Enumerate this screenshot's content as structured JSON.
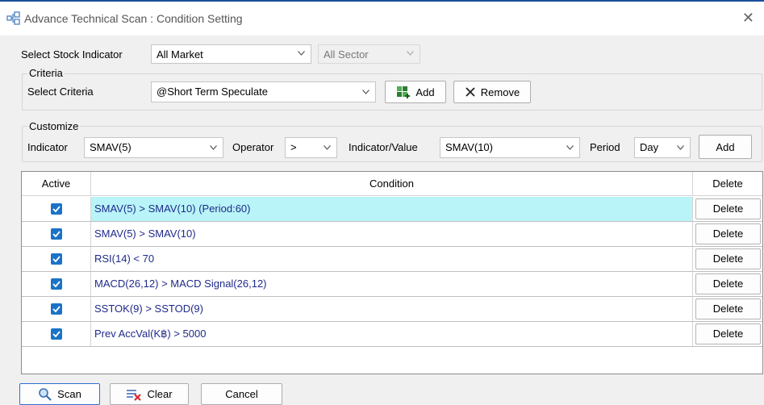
{
  "window": {
    "title": "Advance Technical Scan : Condition Setting"
  },
  "filters": {
    "stock_indicator_label": "Select Stock Indicator",
    "market_value": "All Market",
    "sector_value": "All Sector"
  },
  "criteria": {
    "group_title": "Criteria",
    "select_label": "Select Criteria",
    "selected_value": "@Short Term Speculate",
    "add_label": "Add",
    "remove_label": "Remove"
  },
  "customize": {
    "group_title": "Customize",
    "indicator_label": "Indicator",
    "indicator_value": "SMAV(5)",
    "operator_label": "Operator",
    "operator_value": ">",
    "ind_value_label": "Indicator/Value",
    "ind_value_value": "SMAV(10)",
    "period_label": "Period",
    "period_value": "Day",
    "add_label": "Add"
  },
  "grid": {
    "headers": {
      "active": "Active",
      "condition": "Condition",
      "delete": "Delete"
    },
    "rows": [
      {
        "active": true,
        "condition": "SMAV(5) > SMAV(10) (Period:60)",
        "delete": "Delete",
        "selected": true
      },
      {
        "active": true,
        "condition": "SMAV(5) > SMAV(10)",
        "delete": "Delete"
      },
      {
        "active": true,
        "condition": "RSI(14) < 70",
        "delete": "Delete"
      },
      {
        "active": true,
        "condition": "MACD(26,12) > MACD Signal(26,12)",
        "delete": "Delete"
      },
      {
        "active": true,
        "condition": "SSTOK(9) > SSTOD(9)",
        "delete": "Delete"
      },
      {
        "active": true,
        "condition": "Prev AccVal(K฿) > 5000",
        "delete": "Delete"
      }
    ]
  },
  "footer": {
    "scan_label": "Scan",
    "clear_label": "Clear",
    "cancel_label": "Cancel"
  },
  "colors": {
    "selected_row": "#b8f4f8",
    "checkbox": "#1a73c7",
    "condition_text": "#1f2a8a"
  },
  "icons": [
    "app-icon",
    "close-icon",
    "chevron-down-icon",
    "add-icon",
    "remove-x-icon",
    "checkmark-icon",
    "search-icon",
    "clear-icon"
  ]
}
